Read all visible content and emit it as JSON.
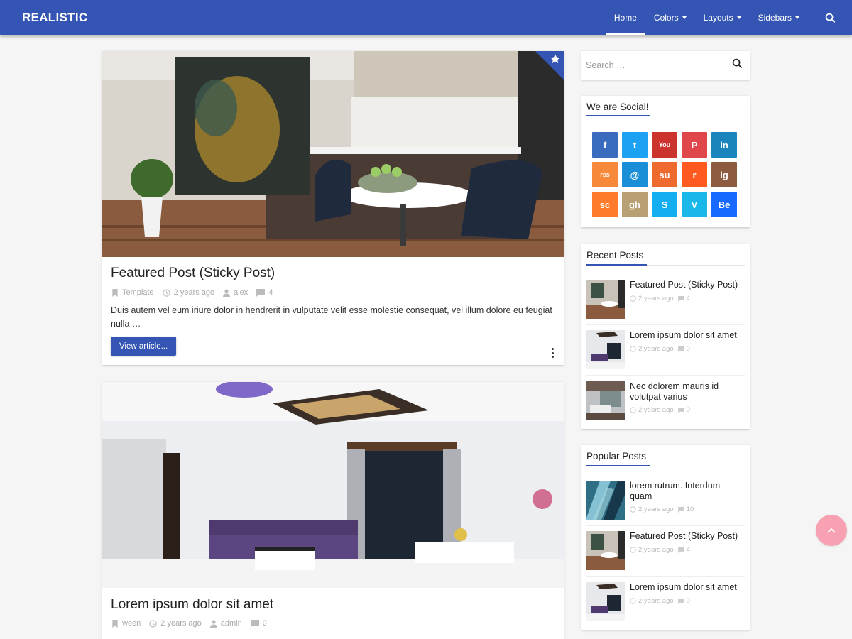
{
  "header": {
    "brand": "REALISTIC",
    "nav": [
      {
        "label": "Home",
        "active": true,
        "dropdown": false
      },
      {
        "label": "Colors",
        "active": false,
        "dropdown": true
      },
      {
        "label": "Layouts",
        "active": false,
        "dropdown": true
      },
      {
        "label": "Sidebars",
        "active": false,
        "dropdown": true
      }
    ],
    "search_icon": "search-icon"
  },
  "posts": [
    {
      "title": "Featured Post (Sticky Post)",
      "category": "Template",
      "date": "2 years ago",
      "author": "alex",
      "comments": "4",
      "excerpt": "Duis autem vel eum iriure dolor in hendrerit in vulputate velit esse molestie consequat, vel illum dolore eu feugiat nulla …",
      "button": "View article...",
      "sticky_icon": "star-icon"
    },
    {
      "title": "Lorem ipsum dolor sit amet",
      "category": "ween",
      "date": "2 years ago",
      "author": "admin",
      "comments": "0"
    }
  ],
  "sidebar": {
    "search_placeholder": "Search …",
    "social": {
      "title": "We are Social!",
      "buttons": [
        {
          "name": "facebook",
          "glyph": "f",
          "color": "#3b6bbd"
        },
        {
          "name": "twitter",
          "glyph": "t",
          "color": "#1da1f2"
        },
        {
          "name": "youtube",
          "glyph": "You",
          "color": "#cd332d"
        },
        {
          "name": "pinterest",
          "glyph": "P",
          "color": "#e0474b"
        },
        {
          "name": "linkedin",
          "glyph": "in",
          "color": "#1a85bc"
        },
        {
          "name": "rss",
          "glyph": "rss",
          "color": "#f7893a"
        },
        {
          "name": "email",
          "glyph": "@",
          "color": "#1a8fd8"
        },
        {
          "name": "stumbleupon",
          "glyph": "su",
          "color": "#ef6a2e"
        },
        {
          "name": "reddit",
          "glyph": "r",
          "color": "#ff5a1f"
        },
        {
          "name": "instagram",
          "glyph": "ig",
          "color": "#8d5b3f"
        },
        {
          "name": "soundcloud",
          "glyph": "sc",
          "color": "#ff7b2c"
        },
        {
          "name": "github",
          "glyph": "gh",
          "color": "#b9a074"
        },
        {
          "name": "skype",
          "glyph": "S",
          "color": "#12aef0"
        },
        {
          "name": "vimeo",
          "glyph": "V",
          "color": "#1ab7ea"
        },
        {
          "name": "behance",
          "glyph": "Bē",
          "color": "#1769ff"
        }
      ]
    },
    "recent": {
      "title": "Recent Posts",
      "items": [
        {
          "title": "Featured Post (Sticky Post)",
          "date": "2 years ago",
          "comments": "4"
        },
        {
          "title": "Lorem ipsum dolor sit amet",
          "date": "2 years ago",
          "comments": "0"
        },
        {
          "title": "Nec dolorem mauris id volutpat varius",
          "date": "2 years ago",
          "comments": "0"
        }
      ]
    },
    "popular": {
      "title": "Popular Posts",
      "items": [
        {
          "title": "lorem rutrum. Interdum quam",
          "date": "2 years ago",
          "comments": "10"
        },
        {
          "title": "Featured Post (Sticky Post)",
          "date": "2 years ago",
          "comments": "4"
        },
        {
          "title": "Lorem ipsum dolor sit amet",
          "date": "2 years ago",
          "comments": "0"
        }
      ]
    }
  },
  "scroll_top_icon": "chevron-up-icon"
}
